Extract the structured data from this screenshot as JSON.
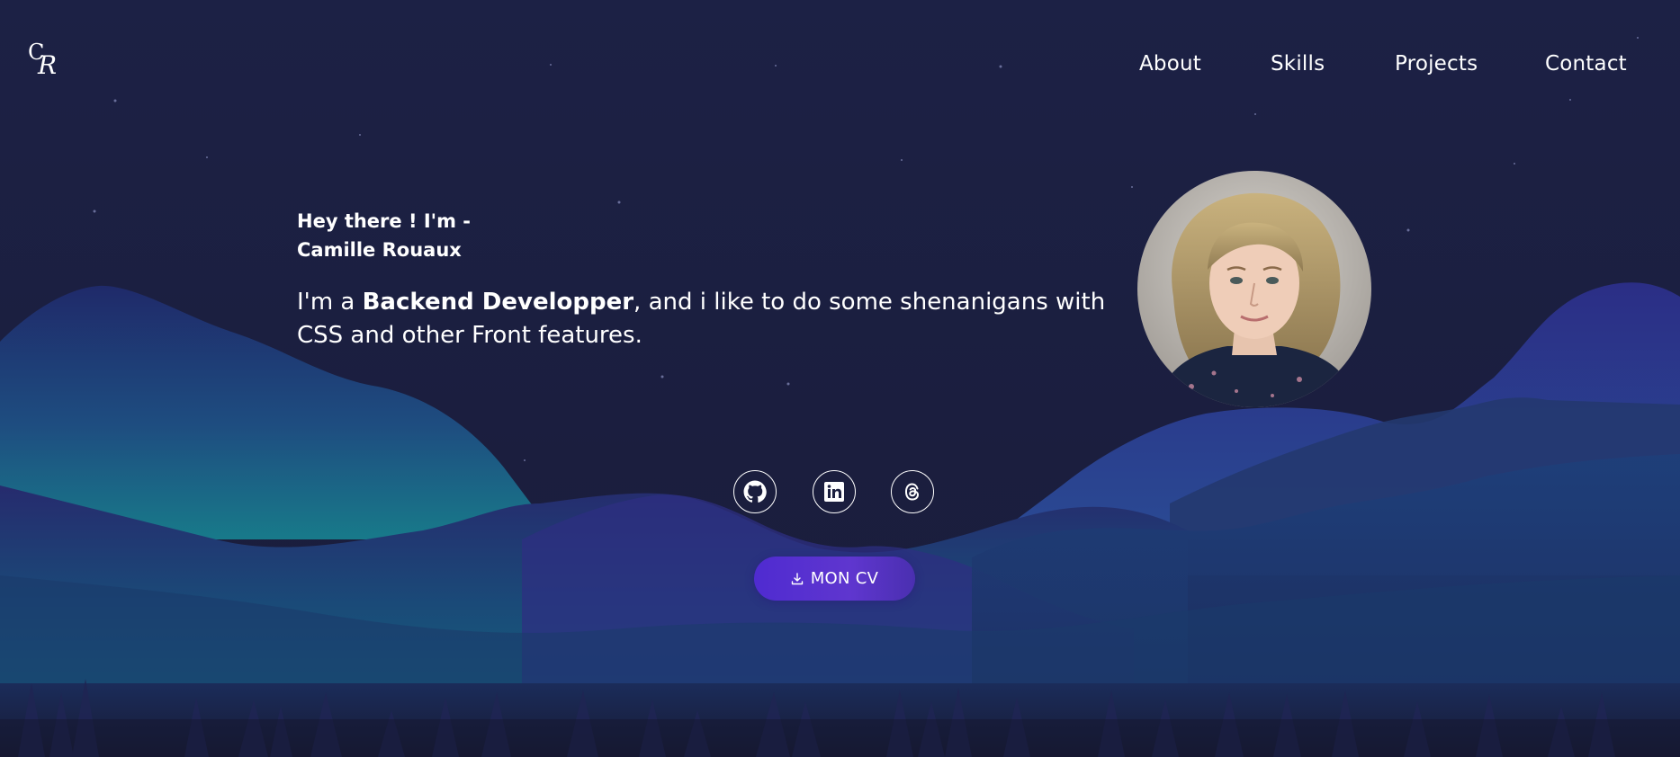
{
  "brand": {
    "logo_initials": "CR"
  },
  "nav": {
    "items": [
      {
        "label": "About"
      },
      {
        "label": "Skills"
      },
      {
        "label": "Projects"
      },
      {
        "label": "Contact"
      }
    ]
  },
  "hero": {
    "greeting_line1": "Hey there ! I'm -",
    "greeting_line2": "Camille Rouaux",
    "tagline_prefix": "I'm a ",
    "tagline_emphasis": "Backend Developper",
    "tagline_suffix": ", and i like to do some shenanigans with CSS and other Front features."
  },
  "socials": [
    {
      "icon": "github-icon"
    },
    {
      "icon": "linkedin-icon"
    },
    {
      "icon": "threads-icon"
    }
  ],
  "cv_button": {
    "icon": "download-icon",
    "label": "MON CV"
  },
  "colors": {
    "background": "#1b1f3f",
    "accent": "#5f36cf",
    "text": "#ffffff"
  }
}
